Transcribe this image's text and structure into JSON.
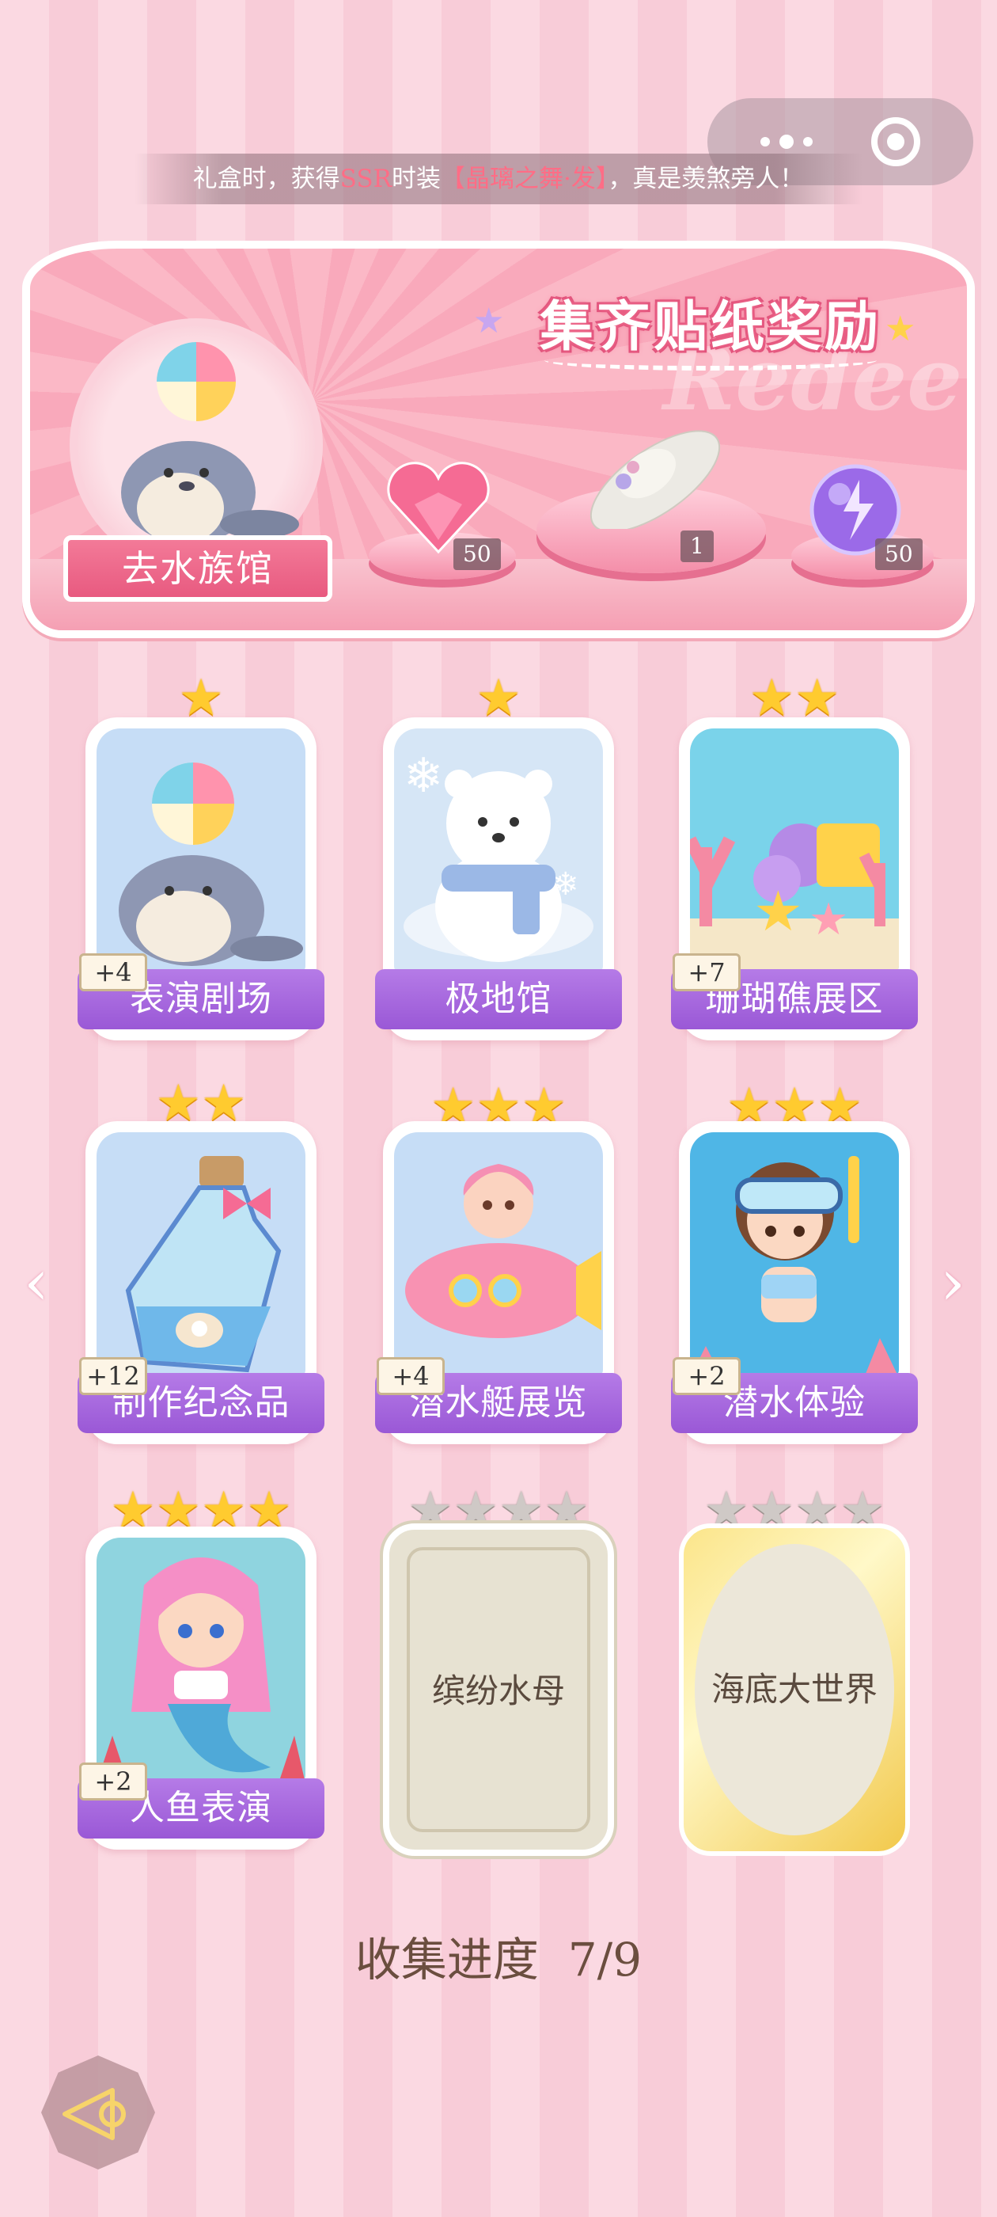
{
  "marquee": {
    "part1": "礼盒时，获得",
    "ssr": "SSR",
    "part2": "时装",
    "item": "【晶璃之舞·发】",
    "part3": "，真是羡煞旁人！"
  },
  "banner": {
    "title": "集齐贴纸奖励",
    "watermark": "Redeem",
    "go_button": "去水族馆",
    "rewards": [
      {
        "name": "heart-gem",
        "qty": "50"
      },
      {
        "name": "hat",
        "qty": "1"
      },
      {
        "name": "purple-orb",
        "qty": "50"
      }
    ]
  },
  "cards": [
    {
      "label": "表演剧场",
      "stars": 1,
      "plus": "+4"
    },
    {
      "label": "极地馆",
      "stars": 1,
      "plus": ""
    },
    {
      "label": "珊瑚礁展区",
      "stars": 2,
      "plus": "+7"
    },
    {
      "label": "制作纪念品",
      "stars": 2,
      "plus": "+12"
    },
    {
      "label": "潜水艇展览",
      "stars": 3,
      "plus": "+4"
    },
    {
      "label": "潜水体验",
      "stars": 3,
      "plus": "+2"
    },
    {
      "label": "人鱼表演",
      "stars": 4,
      "plus": "+2"
    }
  ],
  "locked_cards": [
    {
      "label": "缤纷水母",
      "stars": 4
    },
    {
      "label": "海底大世界",
      "stars": 4
    }
  ],
  "progress": {
    "label": "收集进度",
    "value": "7/9"
  },
  "colors": {
    "accent_pink": "#e85a80",
    "label_purple": "#9a58d6",
    "star_gold": "#ffcb2f"
  }
}
